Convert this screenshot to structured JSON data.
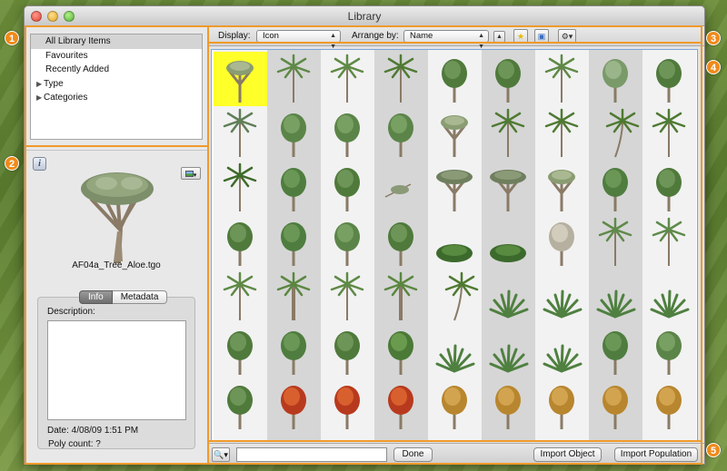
{
  "window": {
    "title": "Library"
  },
  "sidebar": {
    "items": [
      {
        "label": "All Library Items",
        "selected": true,
        "expandable": false
      },
      {
        "label": "Favourites",
        "expandable": false
      },
      {
        "label": "Recently Added",
        "expandable": false
      },
      {
        "label": "Type",
        "expandable": true
      },
      {
        "label": "Categories",
        "expandable": true
      }
    ]
  },
  "preview": {
    "name": "AF04a_Tree_Aloe.tgo",
    "tabs": [
      "Info",
      "Metadata"
    ],
    "active_tab": "Info",
    "description_label": "Description:",
    "description": "",
    "date": "Date: 4/08/09 1:51 PM",
    "poly_count": "Poly count: ?"
  },
  "toolbar": {
    "display_label": "Display:",
    "display_value": "Icon",
    "arrange_label": "Arrange by:",
    "arrange_value": "Name"
  },
  "grid": {
    "columns": 9,
    "rows": 8,
    "selected_index": 0,
    "item_kinds": [
      "dragon",
      "palm-thin",
      "palm-thin",
      "palm",
      "leafy",
      "leafy",
      "palm-thin",
      "bush-tall",
      "leafy",
      "fern",
      "bush",
      "bush",
      "bush",
      "dragon",
      "palm",
      "palm",
      "palm-bend",
      "palm",
      "cycad",
      "bush-round",
      "leafy",
      "sprig",
      "dragon-wide",
      "dragon-wide",
      "dragon",
      "bush-round",
      "leafy",
      "leafy",
      "bush-round",
      "bush",
      "leafy",
      "shrub-low",
      "shrub-low",
      "bush-white",
      "palm-fan",
      "palm-fan",
      "palm-thin",
      "palm-trunk",
      "palm-thin",
      "palm-trunk",
      "palm-bend",
      "agave",
      "agave",
      "agave",
      "agave",
      "leafy",
      "bush-round",
      "leafy",
      "shrub",
      "agave",
      "agave",
      "agave",
      "bush-round",
      "bush",
      "leafy",
      "autumn",
      "autumn",
      "autumn",
      "autumn-bare",
      "autumn-bare",
      "autumn-bare",
      "autumn-bare",
      "autumn-bare",
      "autumn",
      "autumn",
      "autumn",
      "autumn",
      "autumn",
      "autumn",
      "autumn",
      "autumn",
      "autumn"
    ]
  },
  "bottom": {
    "search_value": "",
    "done_label": "Done",
    "import_object_label": "Import Object",
    "import_population_label": "Import Population"
  },
  "annotations": [
    "1",
    "2",
    "3",
    "4",
    "5"
  ],
  "colors": {
    "accent": "#f08a1a",
    "selection": "#ffff2a",
    "grid_border": "#7ea6d8"
  }
}
